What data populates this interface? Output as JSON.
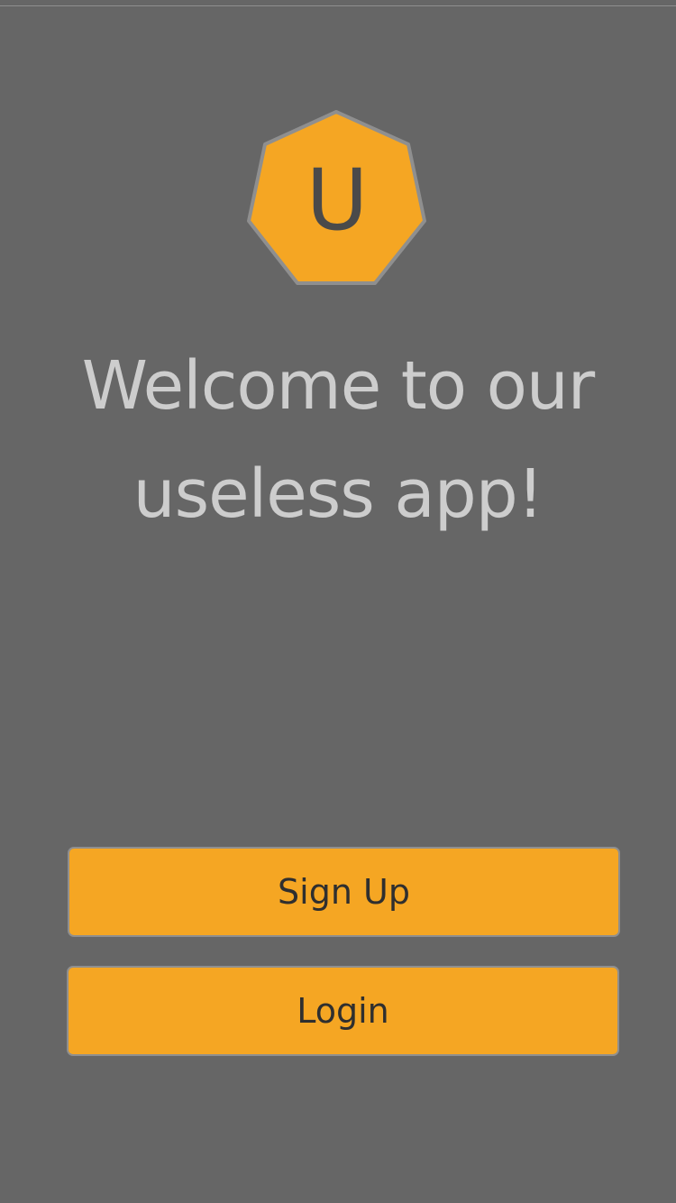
{
  "logo": {
    "letter": "U",
    "icon": "heptagon-logo-icon",
    "fill_color": "#f5a623",
    "stroke_color": "#8f8f8f"
  },
  "welcome": {
    "line1": "Welcome to our",
    "line2": "useless app!"
  },
  "buttons": {
    "signup_label": "Sign Up",
    "login_label": "Login"
  },
  "colors": {
    "background": "#666666",
    "accent": "#f5a623",
    "text_light": "#cdcdcd",
    "text_dark": "#2f2f2f"
  }
}
